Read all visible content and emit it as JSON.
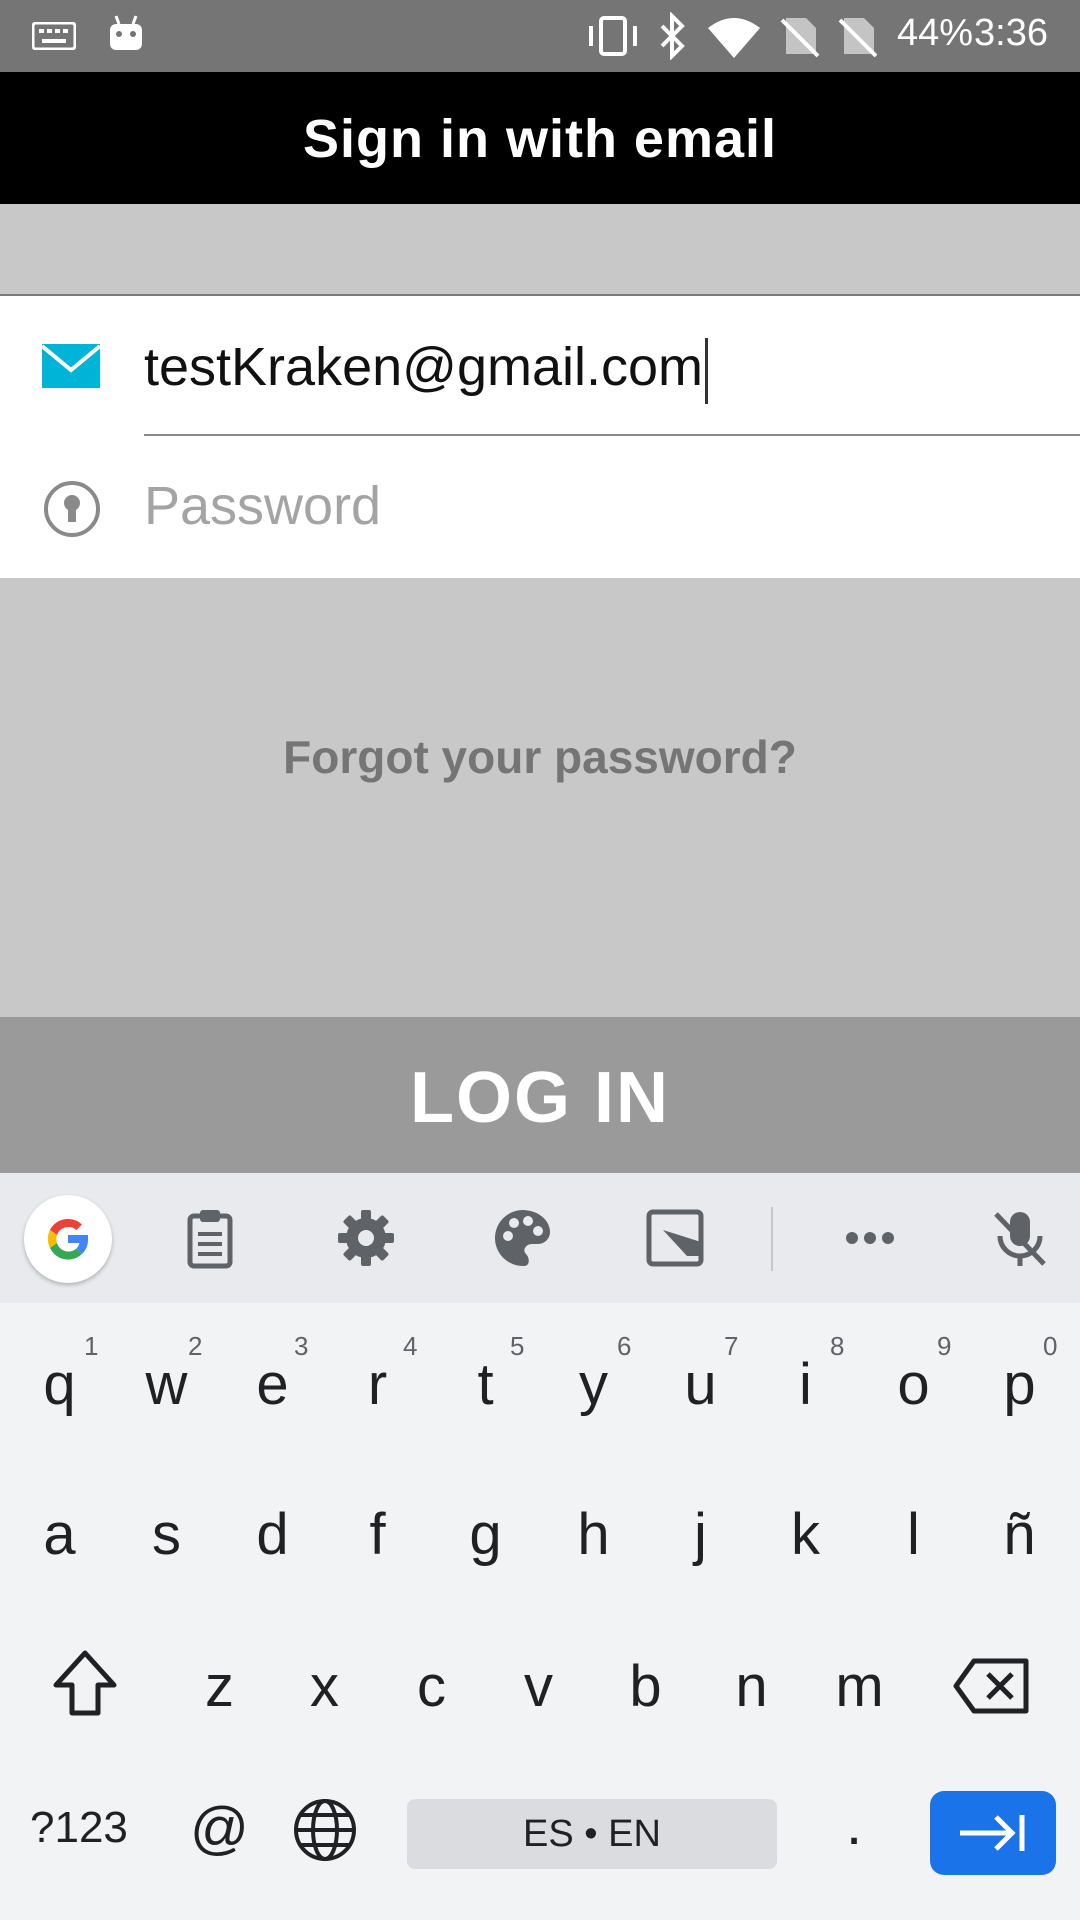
{
  "status_bar": {
    "battery": "44%",
    "time": "3:36",
    "icons": [
      "keyboard-icon",
      "android-icon",
      "vibrate-icon",
      "bluetooth-icon",
      "wifi-icon",
      "no-sim-icon",
      "no-sim-icon",
      "battery-icon"
    ]
  },
  "header": {
    "title": "Sign in with email"
  },
  "form": {
    "email": {
      "value": "testKraken@gmail.com",
      "icon": "mail-icon"
    },
    "password": {
      "placeholder": "Password",
      "icon": "keyhole-icon"
    }
  },
  "links": {
    "forgot": "Forgot your password?"
  },
  "buttons": {
    "login": "LOG IN"
  },
  "keyboard": {
    "toolbar": [
      "google-icon",
      "clipboard-icon",
      "gear-icon",
      "palette-icon",
      "image-edit-icon",
      "more-icon",
      "mic-off-icon"
    ],
    "row1": [
      "q",
      "w",
      "e",
      "r",
      "t",
      "y",
      "u",
      "i",
      "o",
      "p"
    ],
    "row1_hints": [
      "1",
      "2",
      "3",
      "4",
      "5",
      "6",
      "7",
      "8",
      "9",
      "0"
    ],
    "row2": [
      "a",
      "s",
      "d",
      "f",
      "g",
      "h",
      "j",
      "k",
      "l",
      "ñ"
    ],
    "row3": [
      "z",
      "x",
      "c",
      "v",
      "b",
      "n",
      "m"
    ],
    "symbols": "?123",
    "at": "@",
    "space": "ES • EN",
    "period": ".",
    "colors": {
      "enter": "#1a73e8",
      "accent": "#00b4d8"
    }
  }
}
